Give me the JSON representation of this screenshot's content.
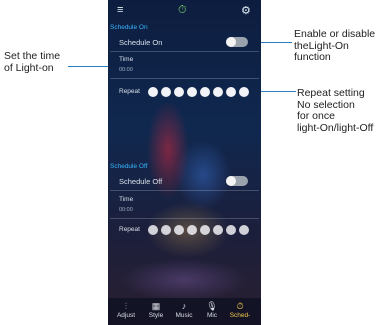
{
  "callouts": {
    "set_time": [
      "Set the time",
      "of Light-on"
    ],
    "enable": [
      "Enable or disable",
      "theLight-On",
      "function"
    ],
    "repeat": [
      "Repeat setting",
      "No selection",
      "for once",
      "light-On/light-Off"
    ]
  },
  "topbar": {
    "menu_icon": "≡",
    "clock_icon": "⏱",
    "settings_icon": "⚙"
  },
  "schedule_on": {
    "section_title": "Schedule On",
    "toggle_label": "Schedule On",
    "time_label": "Time",
    "time_value": "00:00",
    "repeat_label": "Repeat"
  },
  "schedule_off": {
    "section_title": "Schedule Off",
    "toggle_label": "Schedule Off",
    "time_label": "Time",
    "time_value": "00:00",
    "repeat_label": "Repeat"
  },
  "nav": [
    {
      "label": "Adjust",
      "icon": "⫶"
    },
    {
      "label": "Style",
      "icon": "▦"
    },
    {
      "label": "Music",
      "icon": "♪"
    },
    {
      "label": "Mic",
      "icon": "🎙"
    },
    {
      "label": "Sched-",
      "icon": "⏱"
    }
  ],
  "colors": {
    "accent": "#39b6ff",
    "active_tab": "#f1c84b",
    "callout_line": "#2d7fc1"
  }
}
